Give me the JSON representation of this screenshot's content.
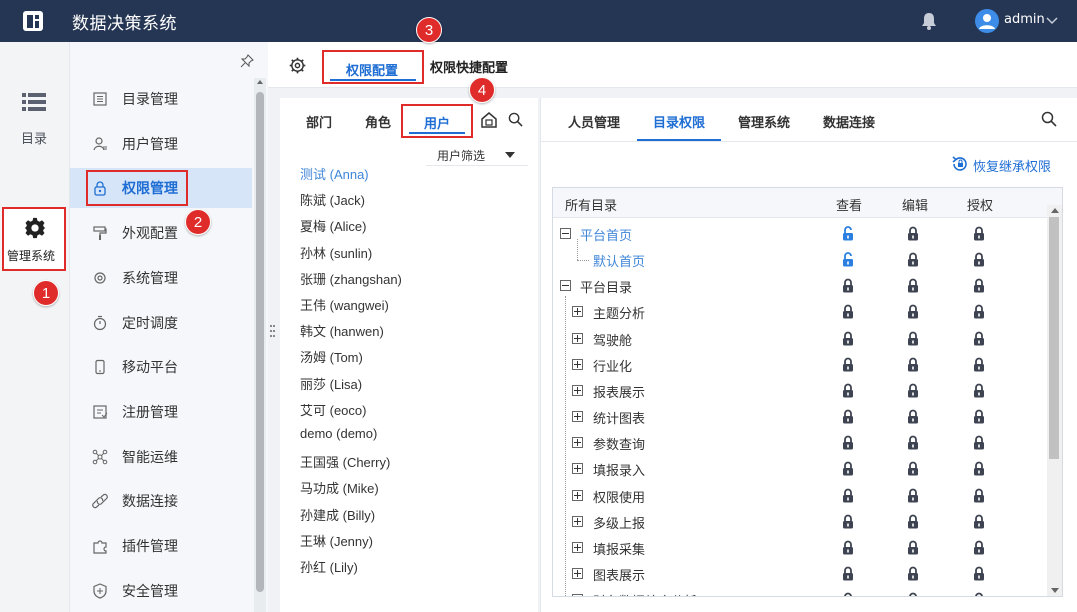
{
  "app": {
    "title": "数据决策系统"
  },
  "header": {
    "user": "admin"
  },
  "rail": {
    "dir_label": "目录",
    "mgmt_label": "管理系统"
  },
  "menu": {
    "items": [
      {
        "label": "目录管理",
        "icon": "directory-icon"
      },
      {
        "label": "用户管理",
        "icon": "user-icon"
      },
      {
        "label": "权限管理",
        "icon": "lock-icon",
        "active": true
      },
      {
        "label": "外观配置",
        "icon": "paint-roller-icon"
      },
      {
        "label": "系统管理",
        "icon": "gear-icon"
      },
      {
        "label": "定时调度",
        "icon": "timer-icon"
      },
      {
        "label": "移动平台",
        "icon": "mobile-icon"
      },
      {
        "label": "注册管理",
        "icon": "register-icon"
      },
      {
        "label": "智能运维",
        "icon": "ops-icon"
      },
      {
        "label": "数据连接",
        "icon": "link-icon"
      },
      {
        "label": "插件管理",
        "icon": "puzzle-icon"
      },
      {
        "label": "安全管理",
        "icon": "shield-icon"
      }
    ]
  },
  "tabs": {
    "main": "权限配置",
    "quick": "权限快捷配置"
  },
  "left_panel": {
    "tabs": [
      "部门",
      "角色",
      "用户"
    ],
    "filter": "用户筛选",
    "users": [
      "测试 (Anna)",
      "陈斌 (Jack)",
      "夏梅 (Alice)",
      "孙林 (sunlin)",
      "张珊 (zhangshan)",
      "王伟 (wangwei)",
      "韩文 (hanwen)",
      "汤姆 (Tom)",
      "丽莎 (Lisa)",
      "艾可 (eoco)",
      "demo (demo)",
      "王国强 (Cherry)",
      "马功成 (Mike)",
      "孙建成 (Billy)",
      "王琳 (Jenny)",
      "孙红 (Lily)"
    ]
  },
  "right_panel": {
    "tabs": [
      "人员管理",
      "目录权限",
      "管理系统",
      "数据连接"
    ],
    "restore": "恢复继承权限",
    "columns": {
      "dir": "所有目录",
      "view": "查看",
      "edit": "编辑",
      "grant": "授权"
    },
    "rows": [
      {
        "label": "平台首页",
        "level": 0,
        "expander": "minus",
        "blue": true,
        "locks": [
          "open",
          "closed",
          "closed"
        ]
      },
      {
        "label": "默认首页",
        "level": 1,
        "expander": "none",
        "blue": true,
        "locks": [
          "open",
          "closed",
          "closed"
        ]
      },
      {
        "label": "平台目录",
        "level": 0,
        "expander": "minus",
        "blue": false,
        "locks": [
          "closed",
          "closed",
          "closed"
        ]
      },
      {
        "label": "主题分析",
        "level": 1,
        "expander": "plus",
        "blue": false,
        "locks": [
          "closed",
          "closed",
          "closed"
        ]
      },
      {
        "label": "驾驶舱",
        "level": 1,
        "expander": "plus",
        "blue": false,
        "locks": [
          "closed",
          "closed",
          "closed"
        ]
      },
      {
        "label": "行业化",
        "level": 1,
        "expander": "plus",
        "blue": false,
        "locks": [
          "closed",
          "closed",
          "closed"
        ]
      },
      {
        "label": "报表展示",
        "level": 1,
        "expander": "plus",
        "blue": false,
        "locks": [
          "closed",
          "closed",
          "closed"
        ]
      },
      {
        "label": "统计图表",
        "level": 1,
        "expander": "plus",
        "blue": false,
        "locks": [
          "closed",
          "closed",
          "closed"
        ]
      },
      {
        "label": "参数查询",
        "level": 1,
        "expander": "plus",
        "blue": false,
        "locks": [
          "closed",
          "closed",
          "closed"
        ]
      },
      {
        "label": "填报录入",
        "level": 1,
        "expander": "plus",
        "blue": false,
        "locks": [
          "closed",
          "closed",
          "closed"
        ]
      },
      {
        "label": "权限使用",
        "level": 1,
        "expander": "plus",
        "blue": false,
        "locks": [
          "closed",
          "closed",
          "closed"
        ]
      },
      {
        "label": "多级上报",
        "level": 1,
        "expander": "plus",
        "blue": false,
        "locks": [
          "closed",
          "closed",
          "closed"
        ]
      },
      {
        "label": "填报采集",
        "level": 1,
        "expander": "plus",
        "blue": false,
        "locks": [
          "closed",
          "closed",
          "closed"
        ]
      },
      {
        "label": "图表展示",
        "level": 1,
        "expander": "plus",
        "blue": false,
        "locks": [
          "closed",
          "closed",
          "closed"
        ]
      },
      {
        "label": "财务数据综合分析",
        "level": 1,
        "expander": "plus",
        "blue": false,
        "locks": [
          "closed",
          "closed",
          "closed"
        ]
      }
    ]
  },
  "badges": [
    "1",
    "2",
    "3",
    "4"
  ],
  "colors": {
    "topbar": "#253554",
    "accent": "#1f6ed4",
    "highlight": "#e02b2b"
  }
}
